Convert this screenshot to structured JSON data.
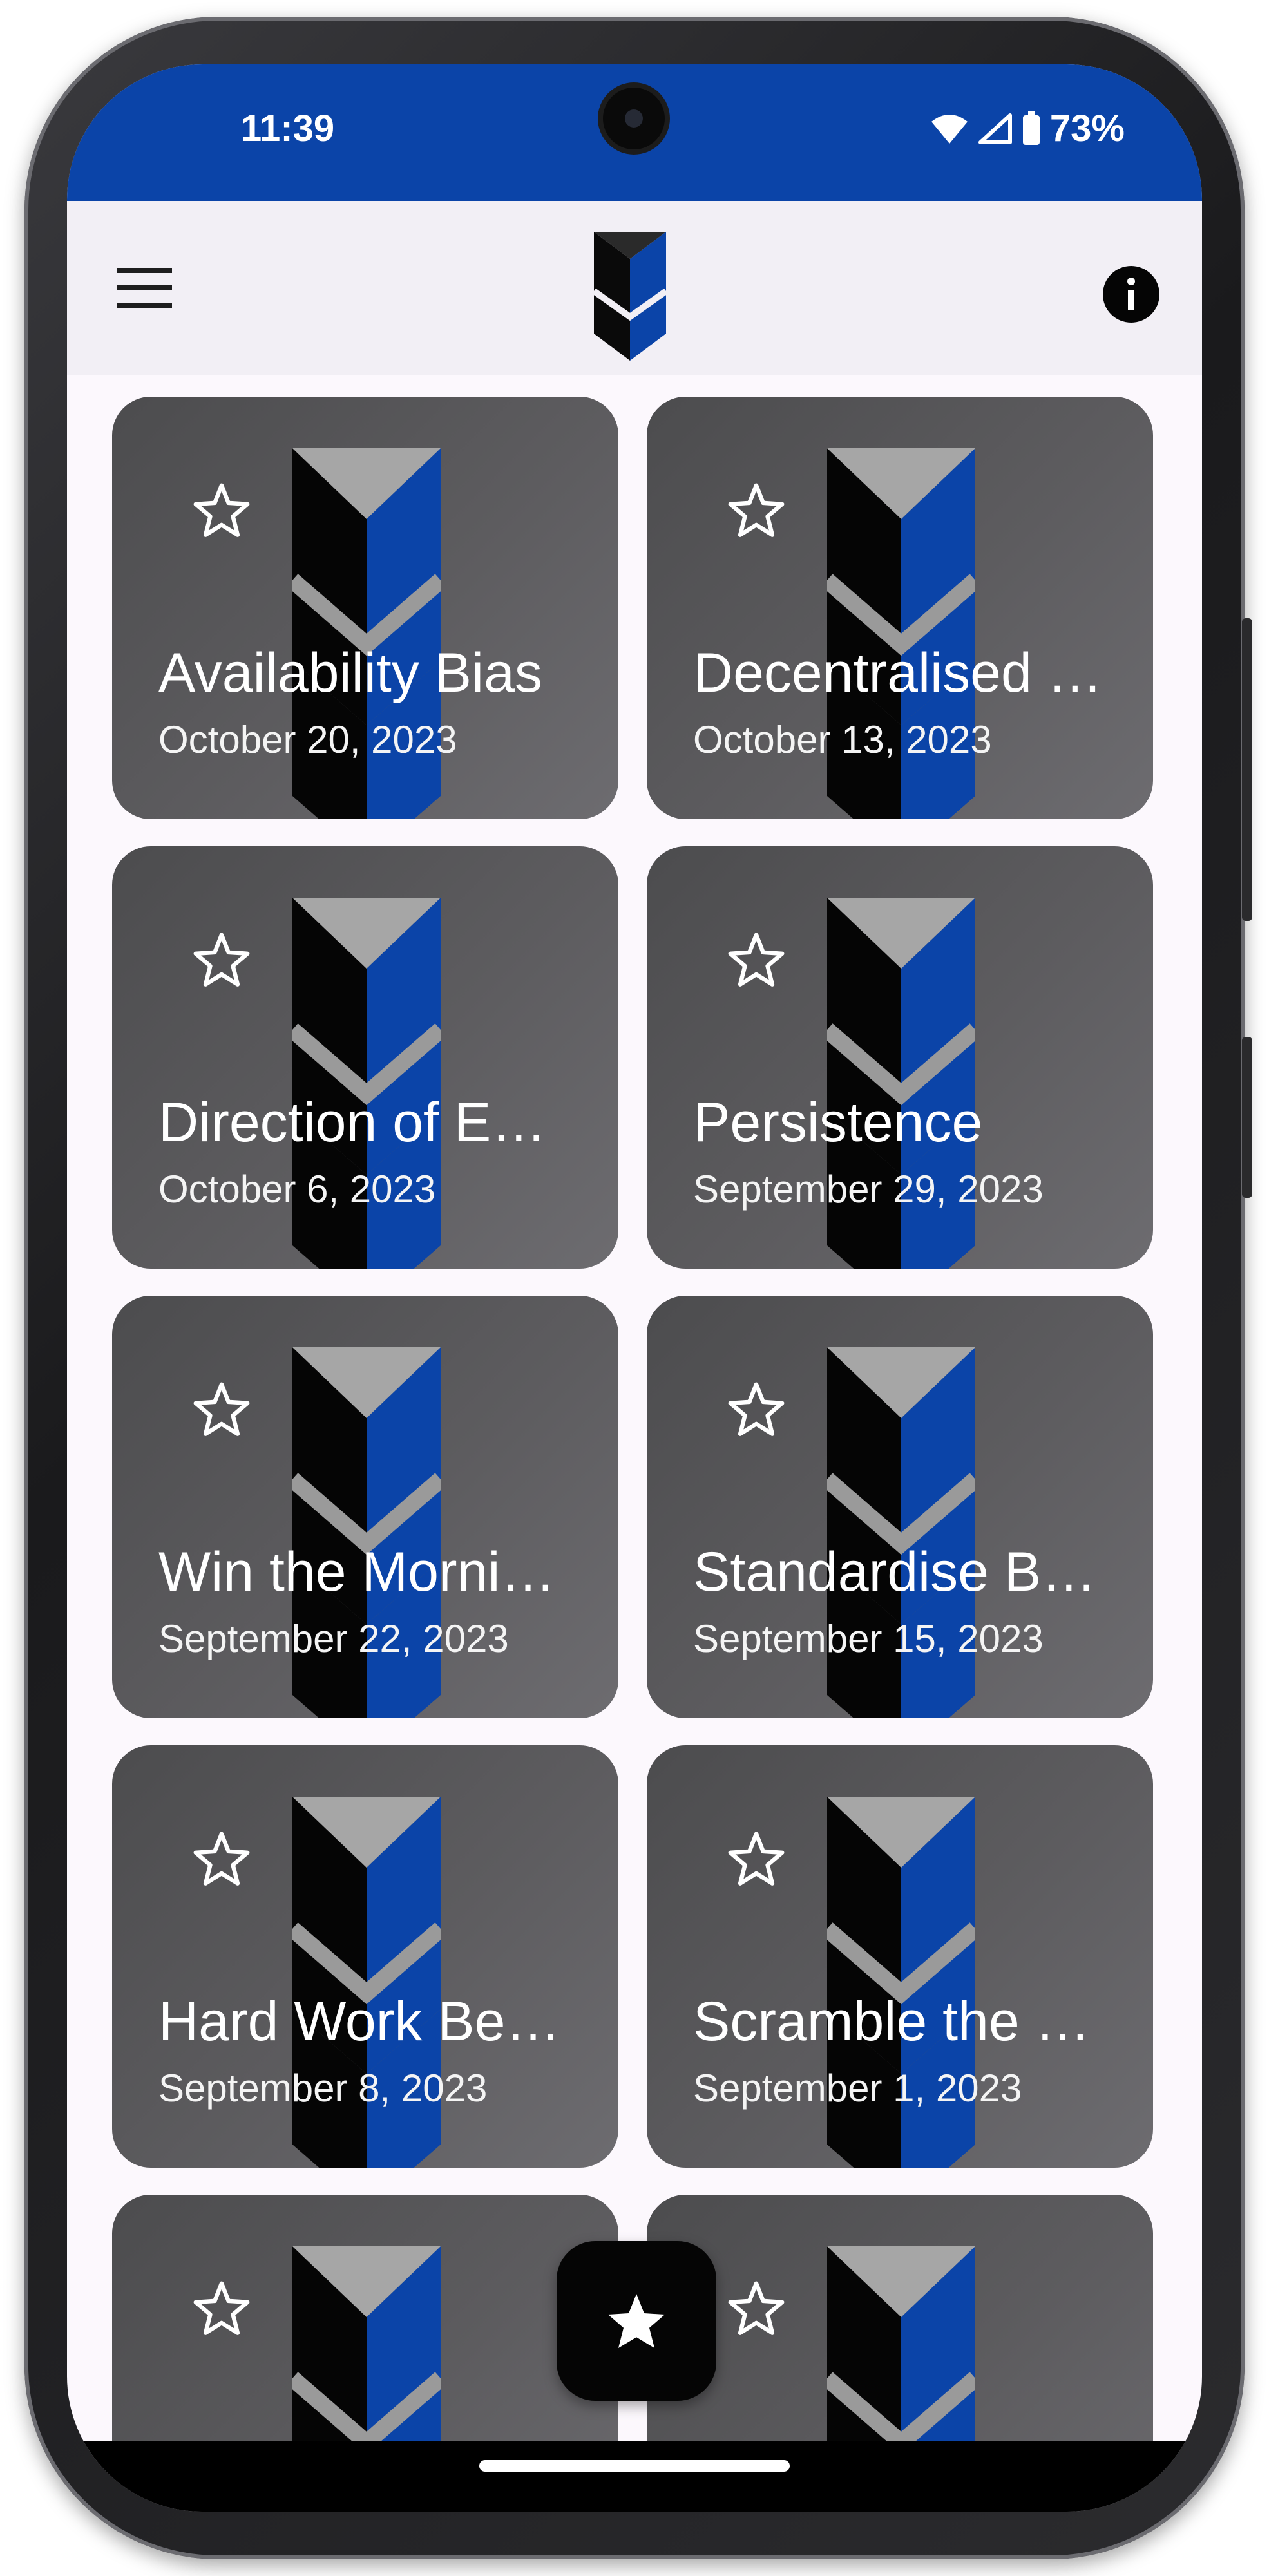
{
  "status_bar": {
    "time": "11:39",
    "battery": "73%",
    "color": "#0b44a8"
  },
  "app_bar": {
    "menu_icon": "hamburger-menu-icon",
    "logo_icon": "app-logo-icon",
    "info_icon": "info-icon"
  },
  "cards": [
    {
      "title": "Availability Bias",
      "date": "October 20, 2023"
    },
    {
      "title": "Decentralised …",
      "date": "October 13, 2023"
    },
    {
      "title": "Direction of E…",
      "date": "October 6, 2023"
    },
    {
      "title": "Persistence",
      "date": "September 29, 2023"
    },
    {
      "title": "Win the Morni…",
      "date": "September 22, 2023"
    },
    {
      "title": "Standardise B…",
      "date": "September 15, 2023"
    },
    {
      "title": "Hard Work Be…",
      "date": "September 8, 2023"
    },
    {
      "title": "Scramble the …",
      "date": "September 1, 2023"
    },
    {
      "title": "",
      "date": ""
    },
    {
      "title": "",
      "date": ""
    }
  ],
  "fab": {
    "icon": "star-filled-icon"
  },
  "colors": {
    "accent_blue": "#0b44a8",
    "card_bg": "#5d5c5f",
    "app_bar_bg": "#f2eff5"
  }
}
